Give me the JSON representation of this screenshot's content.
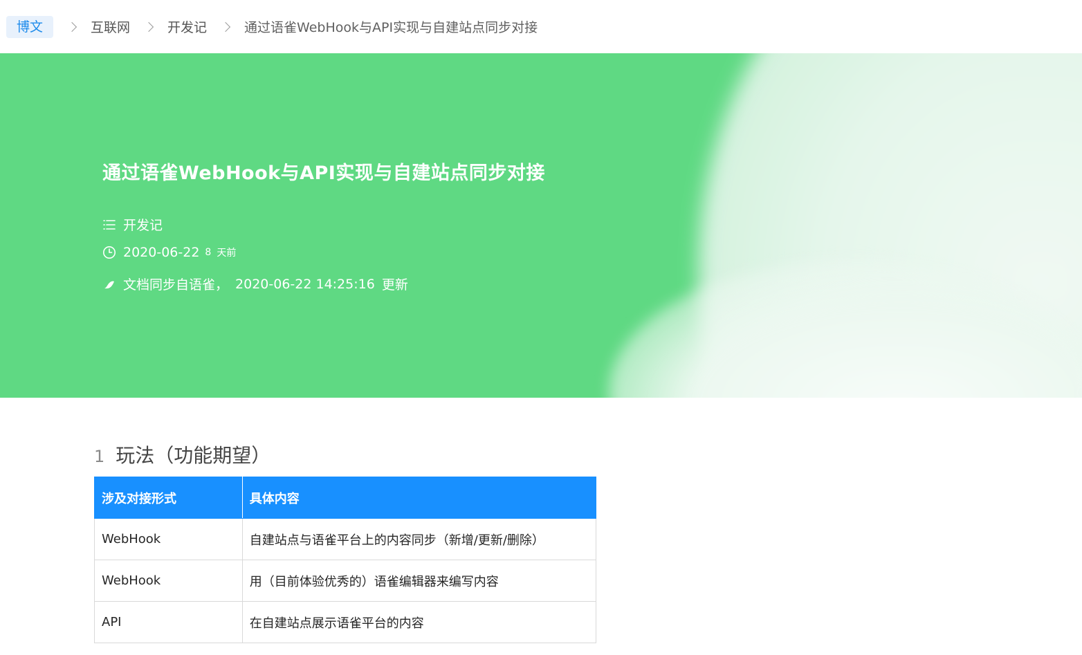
{
  "breadcrumb": {
    "home": "博文",
    "items": [
      "互联网",
      "开发记",
      "通过语雀WebHook与API实现与自建站点同步对接"
    ]
  },
  "hero": {
    "title": "通过语雀WebHook与API实现与自建站点同步对接",
    "category": "开发记",
    "date": "2020-06-22",
    "relative_num": "8",
    "relative_unit": "天前",
    "sync_source": "文档同步自语雀，",
    "updated_at": "2020-06-22 14:25:16",
    "updated_label": "更新",
    "colors": {
      "background": "#5fd983",
      "text": "#ffffff"
    }
  },
  "section": {
    "number": "1",
    "title": "玩法（功能期望）"
  },
  "table": {
    "headers": [
      "涉及对接形式",
      "具体内容"
    ],
    "rows": [
      [
        "WebHook",
        "自建站点与语雀平台上的内容同步（新增/更新/删除）"
      ],
      [
        "WebHook",
        "用（目前体验优秀的）语雀编辑器来编写内容"
      ],
      [
        "API",
        "在自建站点展示语雀平台的内容"
      ]
    ],
    "header_color": "#1890ff"
  },
  "icons": {
    "category": "list-icon",
    "date": "clock-icon",
    "sync": "leaf-icon",
    "separator": "chevron-right-icon"
  }
}
